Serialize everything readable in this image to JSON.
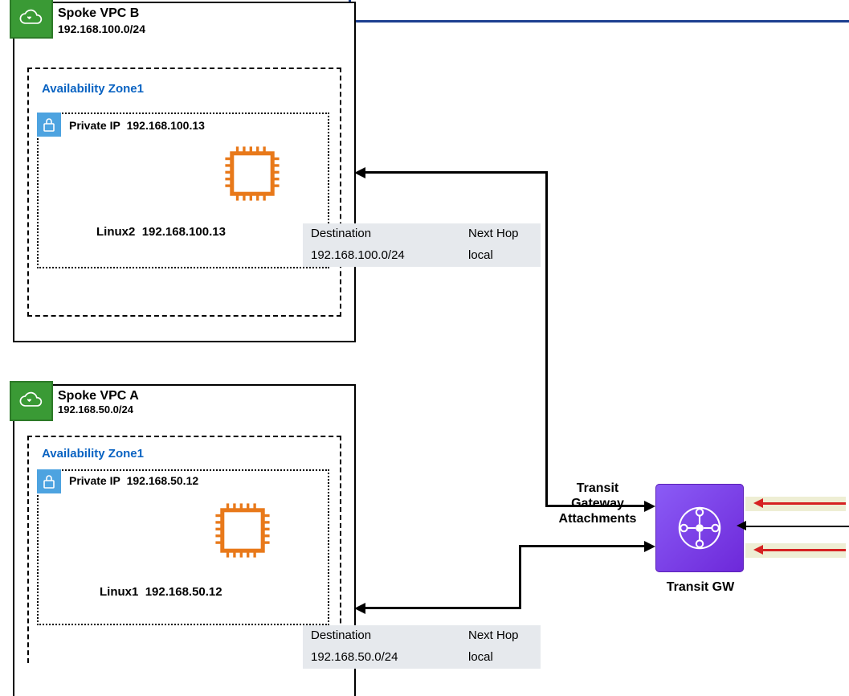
{
  "vpc_b": {
    "title": "Spoke VPC B",
    "cidr": "192.168.100.0/24",
    "az_label": "Availability Zone1",
    "subnet": {
      "label_prefix": "Private IP",
      "ip": "192.168.100.13"
    },
    "instance": {
      "name": "Linux2",
      "ip": "192.168.100.13"
    },
    "route_table": {
      "headers": {
        "dest": "Destination",
        "next": "Next Hop"
      },
      "row": {
        "dest": "192.168.100.0/24",
        "next": "local"
      }
    }
  },
  "vpc_a": {
    "title": "Spoke VPC A",
    "cidr": "192.168.50.0/24",
    "az_label": "Availability Zone1",
    "subnet": {
      "label_prefix": "Private IP",
      "ip": "192.168.50.12"
    },
    "instance": {
      "name": "Linux1",
      "ip": "192.168.50.12"
    },
    "route_table": {
      "headers": {
        "dest": "Destination",
        "next": "Next Hop"
      },
      "row": {
        "dest": "192.168.50.0/24",
        "next": "local"
      }
    }
  },
  "tgw": {
    "attach_label": "Transit Gateway Attachments",
    "label": "Transit GW"
  }
}
